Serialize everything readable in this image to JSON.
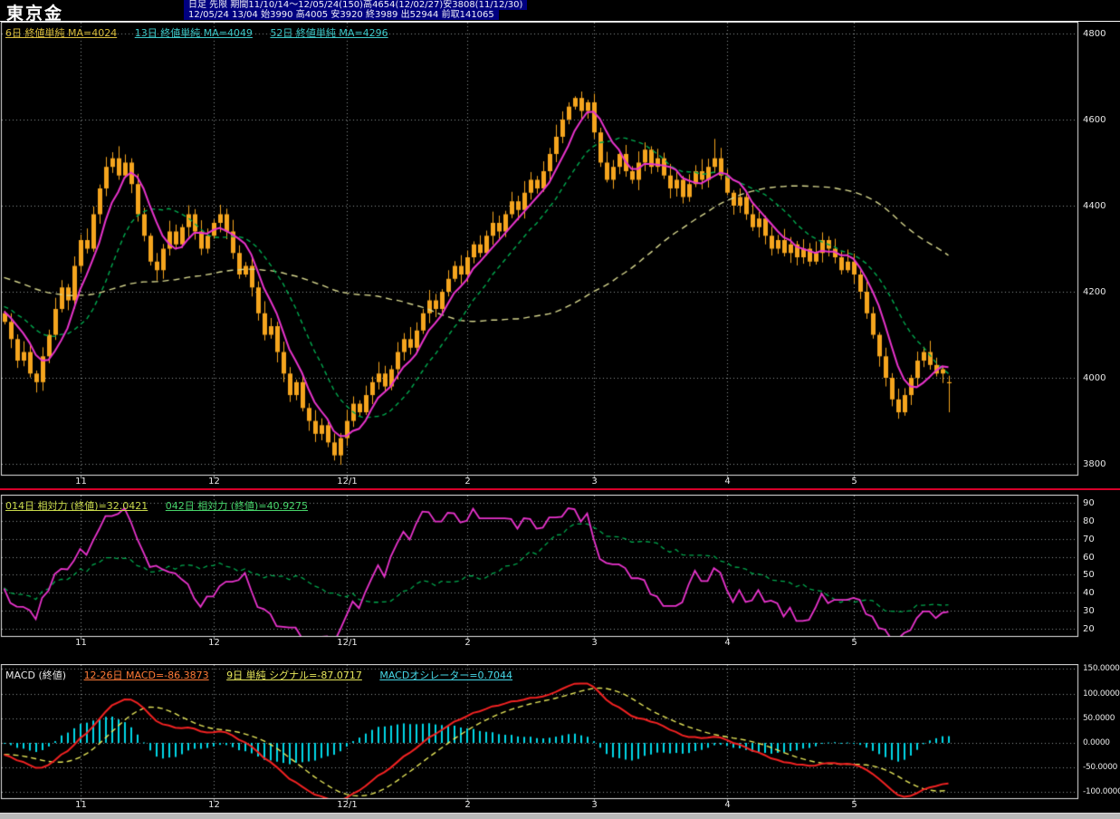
{
  "header": {
    "title": "東京金",
    "info_line1": "日足 先限  期間11/10/14～12/05/24(150)高4654(12/02/27)安3808(11/12/30)",
    "info_line2": "12/05/24 13/04 始3990 高4005 安3920 終3989 出52944 前取141065",
    "bg_color": "#000080"
  },
  "colors": {
    "background": "#000000",
    "grid": "#8f9494",
    "border": "#e6e6e6",
    "candle": "#f5a51e",
    "axis_text": "#e8e8e8",
    "separator_red": "#d8002a",
    "scrollbar": "#b9b9b9"
  },
  "price_panel": {
    "legend": [
      {
        "text": "6日 終値単純 MA=4024",
        "color": "#d8bc3c"
      },
      {
        "text": "13日 終値単純 MA=4049",
        "color": "#3cc8c8"
      },
      {
        "text": "52日 終値単純 MA=4296",
        "color": "#3cc8c8"
      }
    ]
  },
  "rsi_panel": {
    "legend": [
      {
        "text": "014日 相対力 (終値)=32.0421",
        "color": "#c8d84a"
      },
      {
        "text": "042日 相対力 (終値)=40.9275",
        "color": "#46d46a"
      }
    ]
  },
  "macd_panel": {
    "legend": [
      {
        "text": "MACD (終値)",
        "color": "#e8e8e8"
      },
      {
        "text": "12-26日 MACD=-86.3873",
        "color": "#ff7a36"
      },
      {
        "text": "9日 単純 シグナル=-87.0717",
        "color": "#e6e65a"
      },
      {
        "text": "MACDオシレーター=0.7044",
        "color": "#46d8e8"
      }
    ]
  },
  "chart_data": [
    {
      "type": "candlestick",
      "title": "東京金 日足 先限 2011/10/14-2012/05/24 (150本)",
      "ylim": [
        3800,
        4800
      ],
      "y_ticks": [
        4800,
        4600,
        4400,
        4200,
        4000,
        3800
      ],
      "x_month_labels": [
        {
          "label": "11",
          "bar": 12
        },
        {
          "label": "12",
          "bar": 33
        },
        {
          "label": "12/1",
          "bar": 54
        },
        {
          "label": "2",
          "bar": 73
        },
        {
          "label": "3",
          "bar": 93
        },
        {
          "label": "4",
          "bar": 114
        },
        {
          "label": "5",
          "bar": 134
        }
      ],
      "close": [
        4130,
        4090,
        4040,
        4060,
        4010,
        3990,
        4050,
        4100,
        4160,
        4210,
        4180,
        4260,
        4320,
        4300,
        4380,
        4440,
        4490,
        4510,
        4470,
        4500,
        4450,
        4380,
        4330,
        4270,
        4250,
        4300,
        4340,
        4310,
        4350,
        4380,
        4340,
        4300,
        4330,
        4360,
        4380,
        4340,
        4290,
        4240,
        4260,
        4210,
        4150,
        4100,
        4120,
        4060,
        4010,
        3960,
        3990,
        3930,
        3900,
        3870,
        3890,
        3850,
        3820,
        3860,
        3900,
        3940,
        3920,
        3960,
        3990,
        4010,
        3980,
        4020,
        4060,
        4090,
        4070,
        4110,
        4150,
        4180,
        4160,
        4200,
        4230,
        4260,
        4240,
        4280,
        4310,
        4290,
        4330,
        4360,
        4340,
        4380,
        4410,
        4390,
        4430,
        4460,
        4440,
        4480,
        4520,
        4560,
        4600,
        4630,
        4650,
        4620,
        4640,
        4570,
        4500,
        4460,
        4490,
        4520,
        4480,
        4460,
        4500,
        4530,
        4490,
        4510,
        4470,
        4440,
        4460,
        4420,
        4450,
        4480,
        4460,
        4490,
        4510,
        4470,
        4430,
        4400,
        4420,
        4380,
        4350,
        4370,
        4330,
        4300,
        4320,
        4290,
        4310,
        4280,
        4300,
        4270,
        4290,
        4320,
        4300,
        4280,
        4250,
        4270,
        4240,
        4200,
        4150,
        4100,
        4050,
        4000,
        3950,
        3920,
        3960,
        4000,
        4040,
        4060,
        4030,
        4010,
        4020,
        3989
      ],
      "first_open": 4150,
      "overrides": {
        "52": {
          "low": 3808
        },
        "90": {
          "high": 4654
        },
        "112": {
          "high": 4555
        },
        "141": {
          "low": 3905
        },
        "149": {
          "open": 3990,
          "high": 4005,
          "low": 3920,
          "close": 3989
        }
      },
      "history_pad": {
        "start": 4350,
        "end": 4150,
        "count": 60
      },
      "moving_averages": [
        {
          "period": 6,
          "current": 4024,
          "style": "solid",
          "color": "#e833cc"
        },
        {
          "period": 13,
          "current": 4049,
          "style": "dashed",
          "color": "#00a84e"
        },
        {
          "period": 52,
          "current": 4296,
          "style": "dashed",
          "color": "#d6d68e"
        }
      ]
    },
    {
      "type": "line",
      "name": "相対力 (RSI)",
      "ylim": [
        20,
        90
      ],
      "y_ticks": [
        90,
        80,
        70,
        60,
        50,
        40,
        30,
        20
      ],
      "series": [
        {
          "period": 14,
          "current": 32.0421,
          "color": "#e833cc",
          "style": "solid"
        },
        {
          "period": 42,
          "current": 40.9275,
          "color": "#00a84e",
          "style": "dashed"
        }
      ]
    },
    {
      "type": "macd",
      "params": {
        "fast": 12,
        "slow": 26,
        "signal_period": 9,
        "signal_type": "単純"
      },
      "ylim": [
        -100,
        150
      ],
      "y_ticks": [
        "150.0000",
        "100.0000",
        "50.0000",
        "0.0000",
        "-50.0000",
        "-100.0000"
      ],
      "current": {
        "macd": -86.3873,
        "signal": -87.0717,
        "oscillator": 0.7044
      },
      "colors": {
        "macd": "#f22222",
        "signal": "#e6e65a",
        "histogram": "#00d8e8"
      }
    }
  ]
}
